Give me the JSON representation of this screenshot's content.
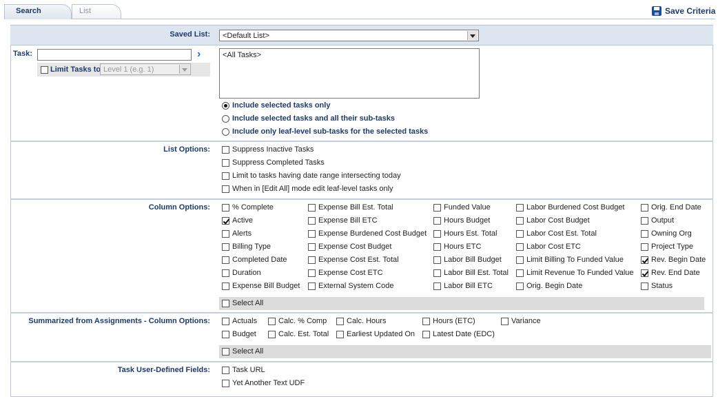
{
  "tabs": {
    "search": "Search",
    "list": "List"
  },
  "save_criteria": "Save Criteria",
  "saved_list": {
    "label": "Saved List:",
    "value": "<Default List>"
  },
  "task": {
    "label": "Task:",
    "limit_label": "Limit Tasks to",
    "level_placeholder": "Level 1 (e.g. 1)",
    "list_item": "<All Tasks>",
    "radios": [
      {
        "label": "Include selected tasks only",
        "selected": true
      },
      {
        "label": "Include selected tasks and all their sub-tasks",
        "selected": false
      },
      {
        "label": "Include only leaf-level sub-tasks for the selected tasks",
        "selected": false
      }
    ]
  },
  "list_options": {
    "label": "List Options:",
    "items": [
      {
        "label": "Suppress Inactive Tasks",
        "checked": false
      },
      {
        "label": "Suppress Completed Tasks",
        "checked": false
      },
      {
        "label": "Limit to tasks having date range intersecting today",
        "checked": false
      },
      {
        "label": "When in [Edit All] mode edit leaf-level tasks only",
        "checked": false
      }
    ]
  },
  "column_options": {
    "label": "Column Options:",
    "columns": [
      [
        {
          "label": "% Complete",
          "checked": false
        },
        {
          "label": "Active",
          "checked": true
        },
        {
          "label": "Alerts",
          "checked": false
        },
        {
          "label": "Billing Type",
          "checked": false
        },
        {
          "label": "Completed Date",
          "checked": false
        },
        {
          "label": "Duration",
          "checked": false
        },
        {
          "label": "Expense Bill Budget",
          "checked": false
        }
      ],
      [
        {
          "label": "Expense Bill Est. Total",
          "checked": false
        },
        {
          "label": "Expense Bill ETC",
          "checked": false
        },
        {
          "label": "Expense Burdened Cost Budget",
          "checked": false
        },
        {
          "label": "Expense Cost Budget",
          "checked": false
        },
        {
          "label": "Expense Cost Est. Total",
          "checked": false
        },
        {
          "label": "Expense Cost ETC",
          "checked": false
        },
        {
          "label": "External System Code",
          "checked": false
        }
      ],
      [
        {
          "label": "Funded Value",
          "checked": false
        },
        {
          "label": "Hours Budget",
          "checked": false
        },
        {
          "label": "Hours Est. Total",
          "checked": false
        },
        {
          "label": "Hours ETC",
          "checked": false
        },
        {
          "label": "Labor Bill Budget",
          "checked": false
        },
        {
          "label": "Labor Bill Est. Total",
          "checked": false
        },
        {
          "label": "Labor Bill ETC",
          "checked": false
        }
      ],
      [
        {
          "label": "Labor Burdened Cost Budget",
          "checked": false
        },
        {
          "label": "Labor Cost Budget",
          "checked": false
        },
        {
          "label": "Labor Cost Est. Total",
          "checked": false
        },
        {
          "label": "Labor Cost ETC",
          "checked": false
        },
        {
          "label": "Limit Billing To Funded Value",
          "checked": false
        },
        {
          "label": "Limit Revenue To Funded Value",
          "checked": false
        },
        {
          "label": "Orig. Begin Date",
          "checked": false
        }
      ],
      [
        {
          "label": "Orig. End Date",
          "checked": false
        },
        {
          "label": "Output",
          "checked": false
        },
        {
          "label": "Owning Org",
          "checked": false
        },
        {
          "label": "Project Type",
          "checked": false
        },
        {
          "label": "Rev. Begin Date",
          "checked": true
        },
        {
          "label": "Rev. End Date",
          "checked": true
        },
        {
          "label": "Status",
          "checked": false
        }
      ]
    ],
    "select_all": "Select All"
  },
  "summarized": {
    "label": "Summarized from Assignments - Column Options:",
    "columns": [
      [
        {
          "label": "Actuals",
          "checked": false
        },
        {
          "label": "Budget",
          "checked": false
        }
      ],
      [
        {
          "label": "Calc. % Comp",
          "checked": false
        },
        {
          "label": "Calc. Est. Total",
          "checked": false
        }
      ],
      [
        {
          "label": "Calc. Hours",
          "checked": false
        },
        {
          "label": "Earliest Updated On",
          "checked": false
        }
      ],
      [
        {
          "label": "Hours (ETC)",
          "checked": false
        },
        {
          "label": "Latest Date (EDC)",
          "checked": false
        }
      ],
      [
        {
          "label": "Variance",
          "checked": false
        }
      ]
    ],
    "select_all": "Select All"
  },
  "udf": {
    "label": "Task User-Defined Fields:",
    "items": [
      {
        "label": "Task URL",
        "checked": false
      },
      {
        "label": "Yet Another Text UDF",
        "checked": false
      }
    ]
  }
}
